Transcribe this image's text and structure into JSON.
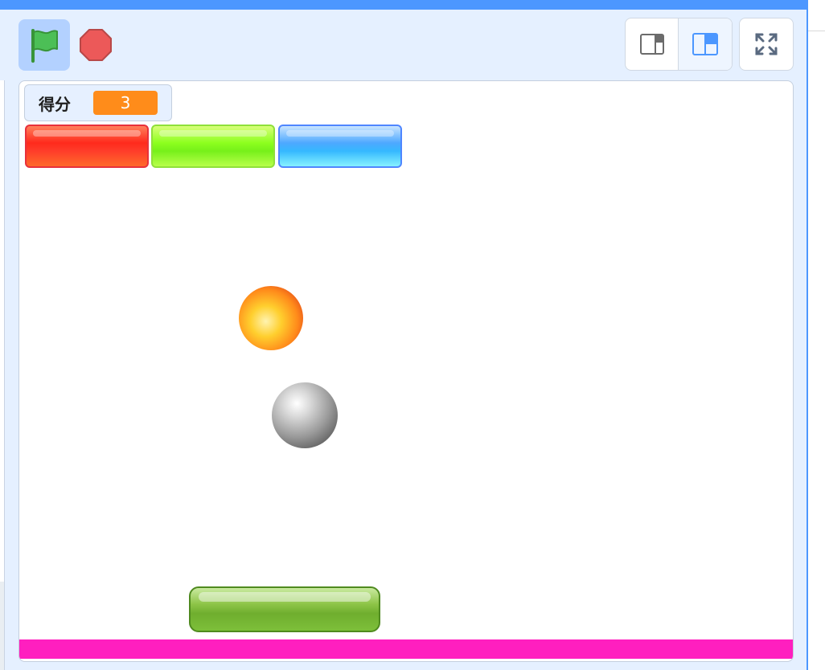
{
  "monitor": {
    "label": "得分",
    "value": "3"
  },
  "controls": {
    "green_flag_icon": "green-flag-icon",
    "stop_icon": "stop-sign-icon",
    "small_stage_icon": "small-stage-icon",
    "normal_stage_icon": "normal-stage-icon",
    "fullscreen_icon": "fullscreen-icon"
  },
  "colors": {
    "accent": "#4c97ff",
    "flag_green": "#4cbf56",
    "stop_red": "#ec5959",
    "monitor_value_bg": "#ff8c1a",
    "floor": "#ff1fbf"
  },
  "sprites": {
    "bricks": [
      {
        "name": "red-brick",
        "color": "#ff2a1c"
      },
      {
        "name": "green-brick",
        "color": "#8cff1e"
      },
      {
        "name": "blue-brick",
        "color": "#4da8ff"
      }
    ],
    "fireball": "fireball",
    "ball": "grey-ball",
    "paddle": "green-paddle"
  }
}
